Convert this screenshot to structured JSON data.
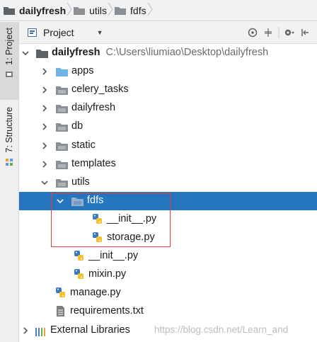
{
  "breadcrumb": [
    {
      "label": "dailyfresh",
      "bold": true
    },
    {
      "label": "utils",
      "bold": false
    },
    {
      "label": "fdfs",
      "bold": false
    }
  ],
  "side_tabs": [
    {
      "label": "1: Project",
      "active": true
    },
    {
      "label": "7: Structure",
      "active": false
    }
  ],
  "panel": {
    "title": "Project",
    "dropdown_icon": "caret-down-icon",
    "tools": [
      "target-icon",
      "collapse-icon",
      "gear-icon",
      "hide-icon"
    ]
  },
  "tree": [
    {
      "label": "dailyfresh",
      "path": "C:\\Users\\liumiao\\Desktop\\dailyfresh",
      "kind": "folder-dark",
      "bold": true,
      "arrow": "down",
      "depth": 0
    },
    {
      "label": "apps",
      "kind": "folder-blue",
      "arrow": "right",
      "depth": 1
    },
    {
      "label": "celery_tasks",
      "kind": "folder-gray",
      "arrow": "right",
      "depth": 1
    },
    {
      "label": "dailyfresh",
      "kind": "folder-gray",
      "arrow": "right",
      "depth": 1
    },
    {
      "label": "db",
      "kind": "folder-gray",
      "arrow": "right",
      "depth": 1
    },
    {
      "label": "static",
      "kind": "folder-gray",
      "arrow": "right",
      "depth": 1
    },
    {
      "label": "templates",
      "kind": "folder-gray",
      "arrow": "right",
      "depth": 1
    },
    {
      "label": "utils",
      "kind": "folder-gray",
      "arrow": "down",
      "depth": 1
    },
    {
      "label": "fdfs",
      "kind": "folder-gray",
      "arrow": "down",
      "depth": 2,
      "selected": true
    },
    {
      "label": "__init__.py",
      "kind": "python",
      "arrow": "",
      "depth": 3
    },
    {
      "label": "storage.py",
      "kind": "python",
      "arrow": "",
      "depth": 3
    },
    {
      "label": "__init__.py",
      "kind": "python",
      "arrow": "",
      "depth": 2
    },
    {
      "label": "mixin.py",
      "kind": "python",
      "arrow": "",
      "depth": 2
    },
    {
      "label": "manage.py",
      "kind": "python",
      "arrow": "",
      "depth": 1
    },
    {
      "label": "requirements.txt",
      "kind": "text",
      "arrow": "",
      "depth": 1
    },
    {
      "label": "External Libraries",
      "kind": "library",
      "arrow": "right",
      "depth": 0
    }
  ],
  "watermark": "https://blog.csdn.net/Learn_and",
  "colors": {
    "selection": "#2675bf",
    "highlight_box": "#e03c3c",
    "folder_blue": "#6fb6e6",
    "folder_gray": "#8a8f96"
  }
}
